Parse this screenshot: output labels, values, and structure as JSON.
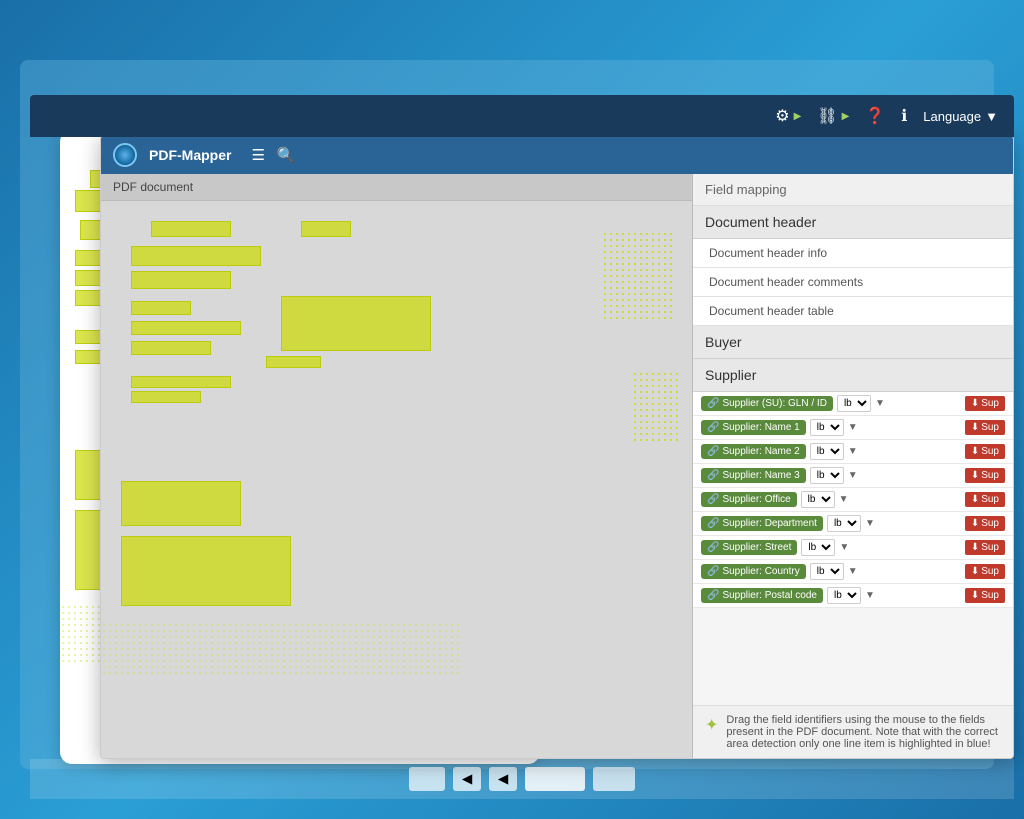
{
  "app": {
    "title": "PDF-Mapper",
    "background_color": "#1a6fa8",
    "top_toolbar": {
      "language_label": "Language",
      "icons": [
        "settings-run-icon",
        "connections-run-icon",
        "help-icon",
        "info-icon"
      ]
    },
    "pdf_panel": {
      "header": "PDF document"
    },
    "field_mapping": {
      "header": "Field mapping",
      "sections": [
        {
          "name": "Document header",
          "items": [
            "Document header info",
            "Document header comments",
            "Document header table"
          ]
        },
        {
          "name": "Buyer",
          "items": []
        },
        {
          "name": "Supplier",
          "items": []
        }
      ],
      "supplier_fields": [
        {
          "label": "Supplier (SU): GLN / ID",
          "select": "lb",
          "btn": "Sup"
        },
        {
          "label": "Supplier: Name 1",
          "select": "lb",
          "btn": "Sup"
        },
        {
          "label": "Supplier: Name 2",
          "select": "lb",
          "btn": "Sup"
        },
        {
          "label": "Supplier: Name 3",
          "select": "lb",
          "btn": "Sup"
        },
        {
          "label": "Supplier: Office",
          "select": "lb",
          "btn": "Sup"
        },
        {
          "label": "Supplier: Department",
          "select": "lb",
          "btn": "Sup"
        },
        {
          "label": "Supplier: Street",
          "select": "lb",
          "btn": "Sup"
        },
        {
          "label": "Supplier: Country",
          "select": "lb",
          "btn": "Sup"
        },
        {
          "label": "Supplier: Postal code",
          "select": "lb",
          "btn": "Sup"
        }
      ]
    },
    "info_bar": {
      "text": "Drag the field identifiers using the mouse to the fields present in the PDF document. Note that with the correct area detection only one line item is highlighted in blue!"
    },
    "bottom_nav": {
      "buttons": [
        "nav-btn-1",
        "nav-btn-2",
        "nav-btn-3",
        "nav-btn-4",
        "nav-btn-5"
      ]
    }
  }
}
